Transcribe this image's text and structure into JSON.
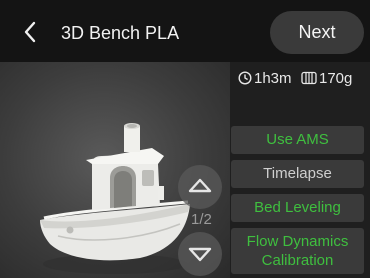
{
  "header": {
    "title": "3D Bench PLA",
    "next_label": "Next"
  },
  "info": {
    "print_time": "1h3m",
    "filament_weight": "170g"
  },
  "viewer": {
    "page_indicator": "1/2"
  },
  "options": {
    "use_ams": "Use AMS",
    "timelapse": "Timelapse",
    "bed_leveling": "Bed Leveling",
    "flow_dynamics_line1": "Flow Dynamics",
    "flow_dynamics_line2": "Calibration"
  },
  "colors": {
    "header_bg": "#141414",
    "enabled_green": "#3fbf3f",
    "disabled_text": "#cfcfcf",
    "option_bg": "#3a3a3a"
  }
}
